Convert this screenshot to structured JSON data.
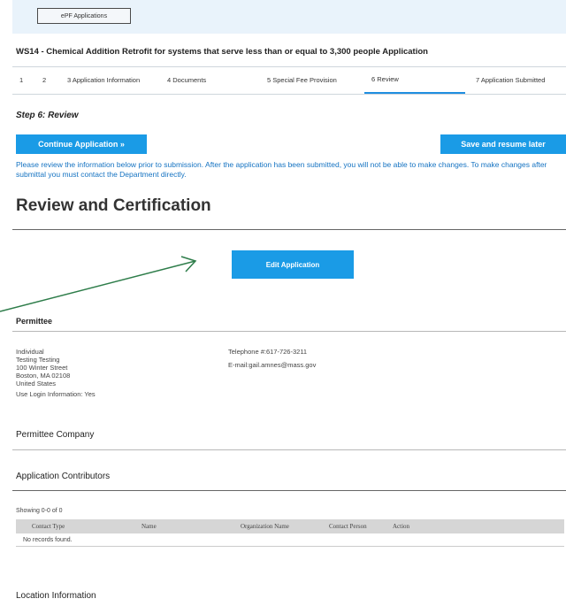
{
  "header": {
    "ebutton_label": "ePF Applications"
  },
  "form_title": "WS14 - Chemical Addition Retrofit for systems that serve less than or equal to 3,300 people Application",
  "steps": [
    {
      "label": "1"
    },
    {
      "label": "2"
    },
    {
      "label": "3 Application Information"
    },
    {
      "label": "4 Documents"
    },
    {
      "label": "5 Special Fee Provision"
    },
    {
      "label": "6 Review"
    },
    {
      "label": "7 Application Submitted"
    }
  ],
  "step_heading": "Step 6: Review",
  "buttons": {
    "continue": "Continue Application »",
    "save_resume": "Save and resume later",
    "edit": "Edit Application"
  },
  "notice": "Please review the information below prior to submission. After the application has been submitted, you will not be able to make changes. To make changes after submittal you must contact the Department directly.",
  "review_heading": "Review and Certification",
  "permittee": {
    "heading": "Permittee",
    "type": "Individual",
    "name": "Testing Testing",
    "street": "100 Winter Street",
    "city": "Boston, MA 02108",
    "country": "United States",
    "telephone": "Telephone #:617-726-3211",
    "email": "E-mail:gail.amnes@mass.gov",
    "use_login": "Use Login Information: Yes"
  },
  "permittee_company_heading": "Permittee Company",
  "contributors": {
    "heading": "Application Contributors",
    "showing": "Showing 0-0 of 0",
    "columns": [
      "Contact Type",
      "Name",
      "Organization Name",
      "Contact Person",
      "Action"
    ],
    "empty_message": "No records found."
  },
  "location_heading": "Location Information",
  "colors": {
    "accent": "#1a9be6",
    "arrow": "#2e7d4a",
    "notice": "#1573c2"
  }
}
